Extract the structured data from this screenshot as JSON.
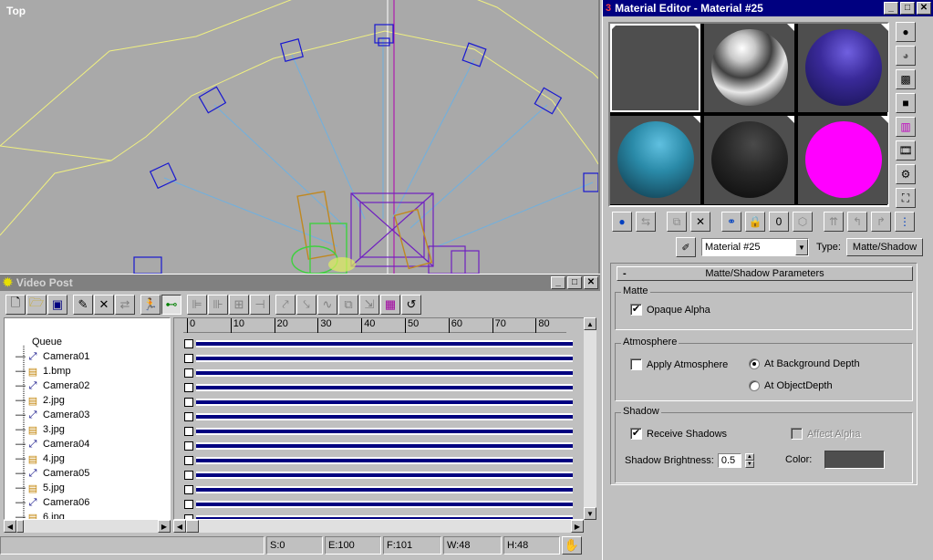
{
  "viewport": {
    "label": "Top"
  },
  "video_post": {
    "title": "Video Post",
    "queue": [
      {
        "label": "Queue",
        "kind": "root"
      },
      {
        "label": "Camera01",
        "kind": "camera"
      },
      {
        "label": "1.bmp",
        "kind": "image"
      },
      {
        "label": "Camera02",
        "kind": "camera"
      },
      {
        "label": "2.jpg",
        "kind": "image"
      },
      {
        "label": "Camera03",
        "kind": "camera"
      },
      {
        "label": "3.jpg",
        "kind": "image"
      },
      {
        "label": "Camera04",
        "kind": "camera"
      },
      {
        "label": "4.jpg",
        "kind": "image"
      },
      {
        "label": "Camera05",
        "kind": "camera"
      },
      {
        "label": "5.jpg",
        "kind": "image"
      },
      {
        "label": "Camera06",
        "kind": "camera"
      },
      {
        "label": "6.jpg",
        "kind": "image"
      }
    ],
    "ruler_ticks": [
      "0",
      "10",
      "20",
      "30",
      "40",
      "50",
      "60",
      "70",
      "80"
    ],
    "track_count": 13,
    "status": {
      "s": "S:0",
      "e": "E:100",
      "f": "F:101",
      "w": "W:48",
      "h": "H:48"
    }
  },
  "material_editor": {
    "title": "Material Editor - Material #25",
    "material_name": "Material #25",
    "type_label": "Type:",
    "type_value": "Matte/Shadow",
    "rollout_title": "Matte/Shadow Parameters",
    "matte": {
      "label": "Matte",
      "opaque_alpha": "Opaque Alpha",
      "opaque_alpha_checked": true
    },
    "atmosphere": {
      "label": "Atmosphere",
      "apply": "Apply Atmosphere",
      "apply_checked": false,
      "at_background": "At Background Depth",
      "at_object": "At ObjectDepth",
      "selected": "at_background"
    },
    "shadow": {
      "label": "Shadow",
      "receive": "Receive Shadows",
      "receive_checked": true,
      "affect_alpha": "Affect Alpha",
      "brightness_label": "Shadow Brightness:",
      "brightness_value": "0.5",
      "color_label": "Color:",
      "color_hex": "#4e4e4e"
    },
    "slot_colors": [
      "#4e4e4e",
      "chrome",
      "#3a2a9a",
      "#2a8aa8",
      "#262626",
      "#ff00ff"
    ]
  }
}
